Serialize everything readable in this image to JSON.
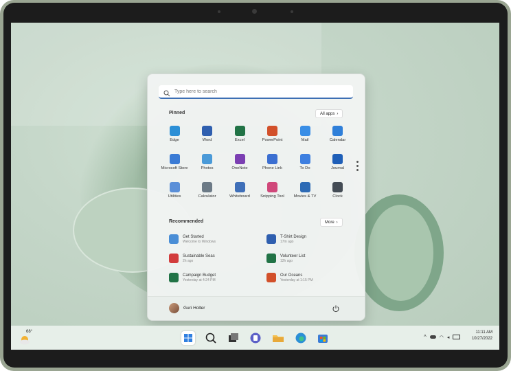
{
  "search": {
    "placeholder": "Type here to search"
  },
  "pinned": {
    "title": "Pinned",
    "all_apps_label": "All apps",
    "apps": [
      {
        "label": "Edge",
        "icon": "edge-icon",
        "color": "#2b8fd6"
      },
      {
        "label": "Word",
        "icon": "word-icon",
        "color": "#2f5faf"
      },
      {
        "label": "Excel",
        "icon": "excel-icon",
        "color": "#217346"
      },
      {
        "label": "PowerPoint",
        "icon": "powerpoint-icon",
        "color": "#d2502a"
      },
      {
        "label": "Mail",
        "icon": "mail-icon",
        "color": "#3a8ee6"
      },
      {
        "label": "Calendar",
        "icon": "calendar-icon",
        "color": "#2f7fd9"
      },
      {
        "label": "Microsoft Store",
        "icon": "store-icon",
        "color": "#3a7bd5"
      },
      {
        "label": "Photos",
        "icon": "photos-icon",
        "color": "#4a9ad8"
      },
      {
        "label": "OneNote",
        "icon": "onenote-icon",
        "color": "#7b3fb2"
      },
      {
        "label": "Phone Link",
        "icon": "phone-link-icon",
        "color": "#3b6fd1"
      },
      {
        "label": "To Do",
        "icon": "todo-icon",
        "color": "#3d7fe0"
      },
      {
        "label": "Journal",
        "icon": "journal-icon",
        "color": "#1f5fb8"
      },
      {
        "label": "Utilities",
        "icon": "utilities-icon",
        "color": "#5a8fd8"
      },
      {
        "label": "Calculator",
        "icon": "calculator-icon",
        "color": "#6c7a86"
      },
      {
        "label": "Whiteboard",
        "icon": "whiteboard-icon",
        "color": "#3f6fb8"
      },
      {
        "label": "Snipping Tool",
        "icon": "snipping-tool-icon",
        "color": "#d0487a"
      },
      {
        "label": "Movies & TV",
        "icon": "movies-tv-icon",
        "color": "#2d6bb5"
      },
      {
        "label": "Clock",
        "icon": "clock-icon",
        "color": "#444c55"
      }
    ]
  },
  "recommended": {
    "title": "Recommended",
    "more_label": "More",
    "items": [
      {
        "name": "Get Started",
        "detail": "Welcome to Windows",
        "icon": "get-started-icon",
        "color": "#4a8ed6"
      },
      {
        "name": "T-Shirt Design",
        "detail": "17m ago",
        "icon": "word-doc-icon",
        "color": "#2f5faf"
      },
      {
        "name": "Sustainable Seas",
        "detail": "2h ago",
        "icon": "pdf-icon",
        "color": "#d23c3c"
      },
      {
        "name": "Volunteer List",
        "detail": "12h ago",
        "icon": "excel-doc-icon",
        "color": "#217346"
      },
      {
        "name": "Campaign Budget",
        "detail": "Yesterday at 4:24 PM",
        "icon": "excel-doc-icon",
        "color": "#217346"
      },
      {
        "name": "Our Oceans",
        "detail": "Yesterday at 1:15 PM",
        "icon": "powerpoint-doc-icon",
        "color": "#d2502a"
      }
    ]
  },
  "user": {
    "name": "Guri Holter"
  },
  "weather": {
    "temperature": "68°"
  },
  "clock": {
    "time": "11:11 AM",
    "date": "10/27/2022"
  },
  "taskbar": {
    "apps": [
      "start-icon",
      "search-icon",
      "task-view-icon",
      "teams-icon",
      "file-explorer-icon",
      "edge-icon",
      "store-icon"
    ]
  }
}
